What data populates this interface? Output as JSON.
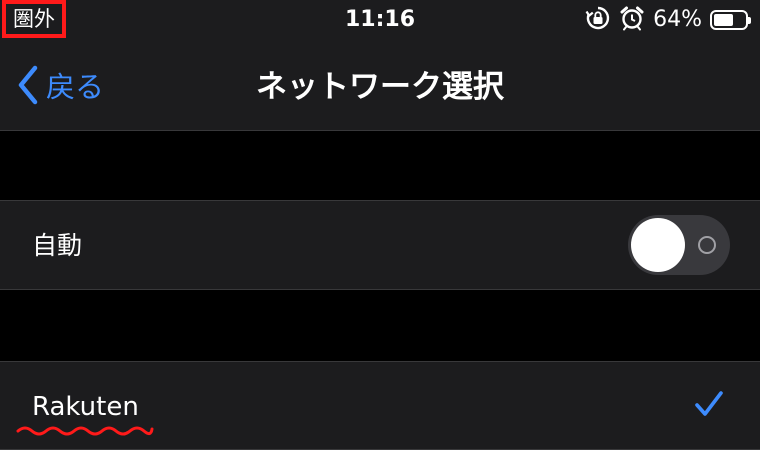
{
  "status_bar": {
    "carrier": "圏外",
    "time": "11:16",
    "battery_percent": "64%",
    "battery_level": 0.64,
    "icons": [
      "rotation-lock-icon",
      "alarm-icon",
      "battery-icon"
    ]
  },
  "nav": {
    "back_label": "戻る",
    "title": "ネットワーク選択"
  },
  "settings": {
    "auto_label": "自動",
    "auto_enabled": false
  },
  "networks": [
    {
      "name": "Rakuten",
      "selected": true
    }
  ],
  "colors": {
    "accent": "#3d8bfd",
    "background": "#000000",
    "cell": "#1c1c1e",
    "highlight": "#ff1a1a"
  }
}
